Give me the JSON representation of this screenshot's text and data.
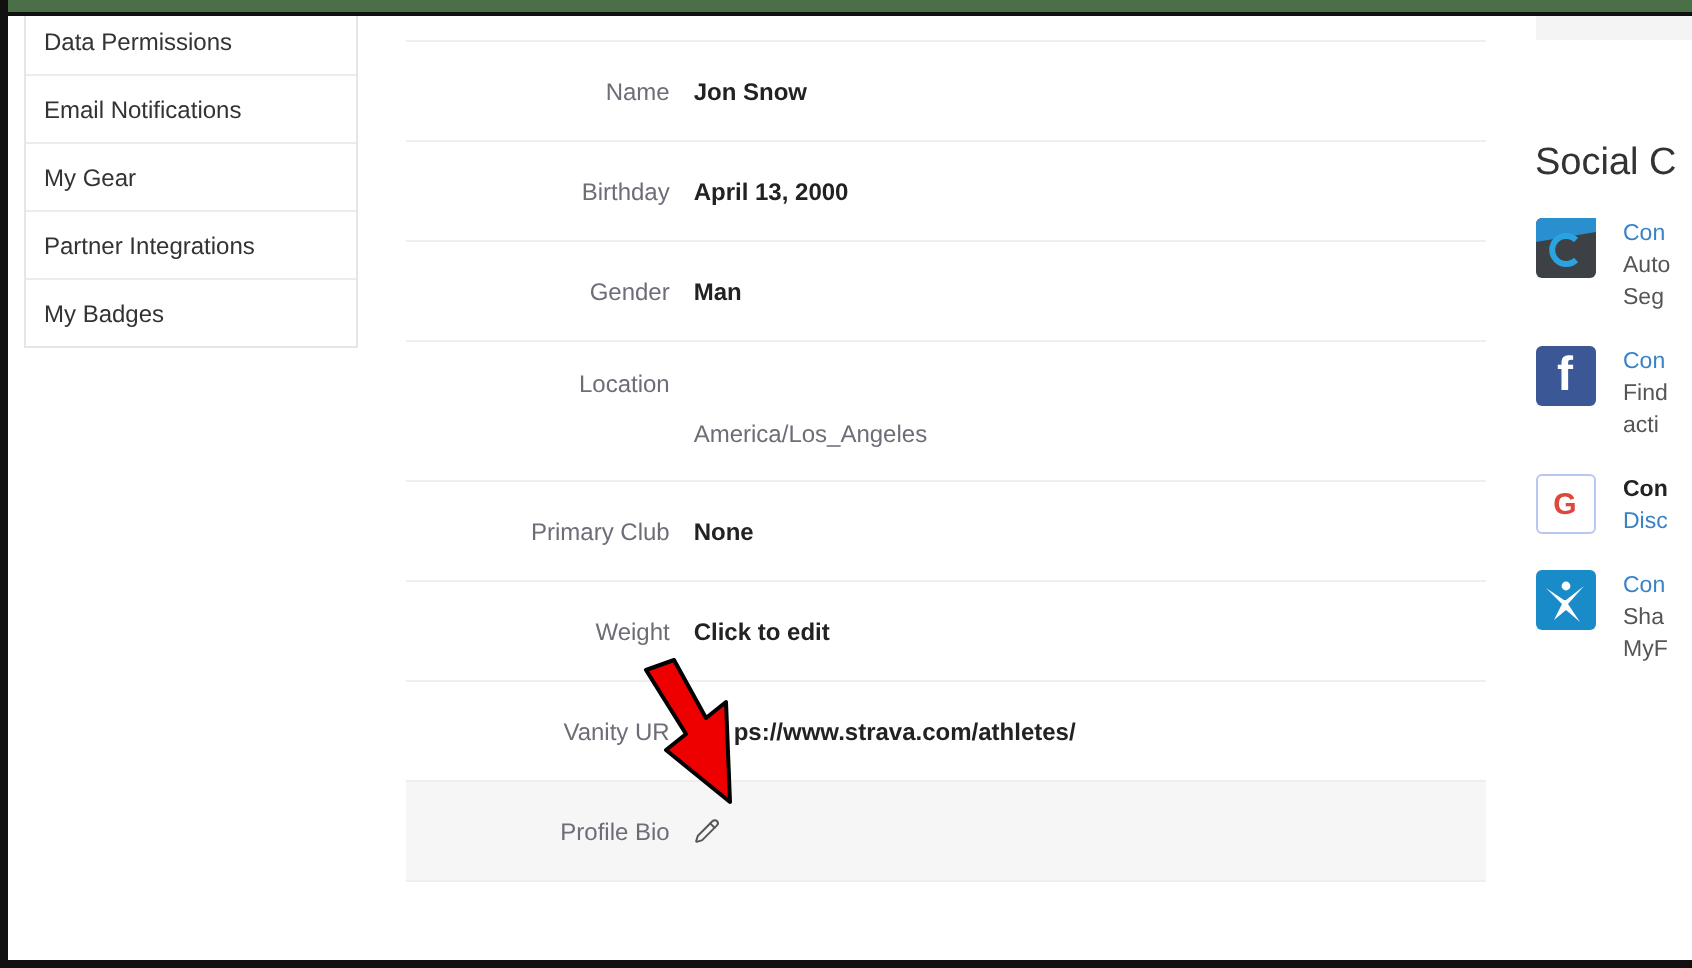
{
  "sidebar": {
    "items": [
      {
        "label": "Data Permissions"
      },
      {
        "label": "Email Notifications"
      },
      {
        "label": "My Gear"
      },
      {
        "label": "Partner Integrations"
      },
      {
        "label": "My Badges"
      }
    ]
  },
  "profile": {
    "fields": [
      {
        "kind": "text",
        "label": "Name",
        "value": "Jon Snow"
      },
      {
        "kind": "text",
        "label": "Birthday",
        "value": "April 13, 2000"
      },
      {
        "kind": "text",
        "label": "Gender",
        "value": "Man"
      },
      {
        "kind": "stacked",
        "label": "Location",
        "value": "America/Los_Angeles"
      },
      {
        "kind": "text",
        "label": "Primary Club",
        "value": "None"
      },
      {
        "kind": "text",
        "label": "Weight",
        "value": "Click to edit"
      },
      {
        "kind": "partial",
        "label": "Vanity UR",
        "value": "ps://www.strava.com/athletes/"
      },
      {
        "kind": "edit",
        "label": "Profile Bio"
      }
    ]
  },
  "social": {
    "title": "Social C",
    "items": [
      {
        "kind": "c-app",
        "lines": [
          {
            "kind": "link",
            "text": "Con"
          },
          {
            "kind": "plain",
            "text": "Auto"
          },
          {
            "kind": "plain",
            "text": "Seg"
          }
        ]
      },
      {
        "kind": "letter",
        "logo_text": "f",
        "lines": [
          {
            "kind": "link",
            "text": "Con"
          },
          {
            "kind": "plain",
            "text": "Find"
          },
          {
            "kind": "plain",
            "text": "acti"
          }
        ]
      },
      {
        "kind": "letter-outline",
        "logo_text": "G",
        "lines": [
          {
            "kind": "bold",
            "text": "Con"
          },
          {
            "kind": "link",
            "text": "Disc"
          }
        ]
      },
      {
        "kind": "figure",
        "lines": [
          {
            "kind": "link",
            "text": "Con"
          },
          {
            "kind": "plain",
            "text": "Sha"
          },
          {
            "kind": "plain",
            "text": "MyF"
          }
        ]
      }
    ]
  }
}
